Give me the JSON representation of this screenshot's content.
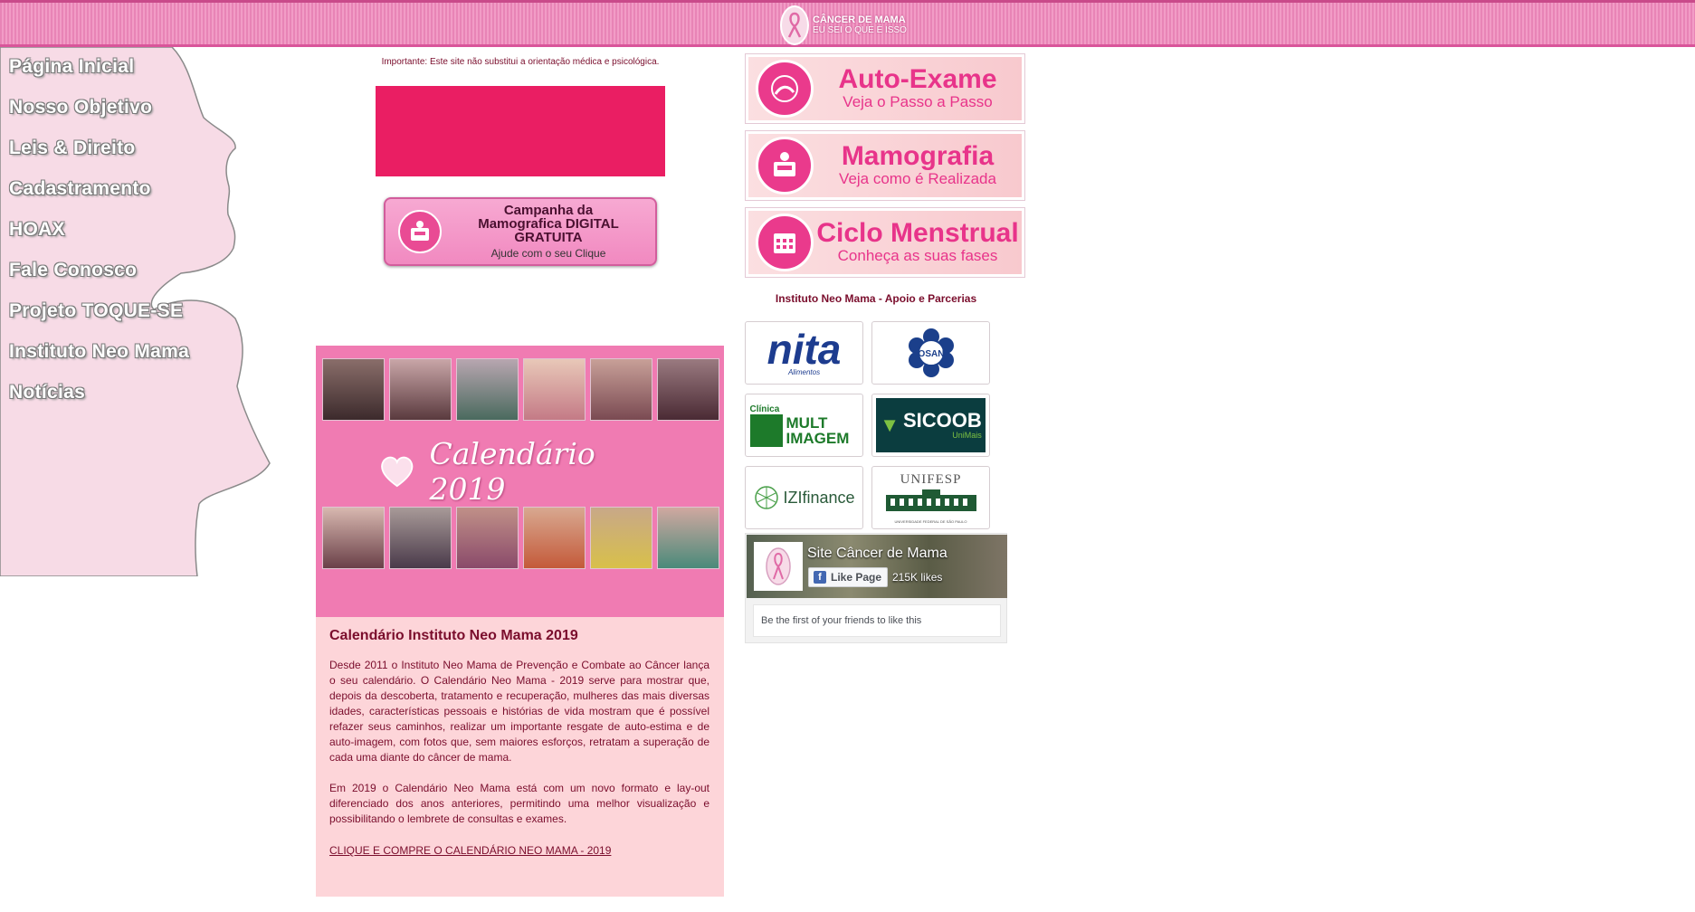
{
  "header": {
    "logo_line1": "CÂNCER DE MAMA",
    "logo_line2": "EU SEI O QUE É ISSO"
  },
  "nav": {
    "items": [
      {
        "label": "Página Inicial"
      },
      {
        "label": "Nosso Objetivo"
      },
      {
        "label": "Leis & Direito"
      },
      {
        "label": "Cadastramento"
      },
      {
        "label": "HOAX"
      },
      {
        "label": "Fale Conosco"
      },
      {
        "label": "Projeto TOQUE-SE"
      },
      {
        "label": "Instituto Neo Mama"
      },
      {
        "label": "Notícias"
      }
    ]
  },
  "notice": "Importante: Este site não substitui a orientação médica e psicológica.",
  "campaign": {
    "line1": "Campanha da",
    "line2": "Mamografica DIGITAL",
    "line3": "GRATUITA",
    "line4": "Ajude com o seu Clique"
  },
  "article": {
    "image_title": "Calendário 2019",
    "heading": "Calendário Instituto Neo Mama 2019",
    "paragraph1": "Desde 2011 o Instituto Neo Mama de Prevenção e Combate ao Câncer lança o seu calendário. O Calendário Neo Mama - 2019 serve para mostrar que, depois da descoberta, tratamento e recuperação, mulheres das mais diversas idades, características pessoais e histórias de vida mostram que é possível refazer seus caminhos, realizar um importante resgate de auto-estima e de auto-imagem, com fotos que, sem maiores esforços, retratam a superação de cada uma diante do câncer de mama.",
    "paragraph2": "Em 2019 o Calendário Neo Mama está com um novo formato e lay-out diferenciado dos anos anteriores, permitindo uma melhor visualização e possibilitando o lembrete de consultas e exames.",
    "link": "CLIQUE E COMPRE O CALENDÁRIO NEO MAMA - 2019"
  },
  "banners": [
    {
      "title": "Auto-Exame",
      "subtitle": "Veja o Passo a Passo"
    },
    {
      "title": "Mamografia",
      "subtitle": "Veja como é Realizada"
    },
    {
      "title": "Ciclo Menstrual",
      "subtitle": "Conheça as suas fases"
    }
  ],
  "partners": {
    "title": "Instituto Neo Mama - Apoio e Parcerias",
    "logos": {
      "nita": "nita",
      "nita_sub": "Alimentos",
      "osan": "OSAN",
      "multimagem_top": "Clínica",
      "multimagem_1": "MULT",
      "multimagem_2": "IMAGEM",
      "sicoob": "SICOOB",
      "sicoob_sub": "UniMais",
      "izi": "IZIfinance",
      "unifesp": "UNIFESP",
      "unifesp_sub": "UNIVERSIDADE FEDERAL DE SÃO PAULO"
    }
  },
  "facebook": {
    "page_name": "Site Câncer de Mama",
    "like_button": "Like Page",
    "likes": "215K likes",
    "friends_text": "Be the first of your friends to like this"
  },
  "colors": {
    "header_pink": "#f29cc6",
    "nav_bg": "#f7dbe6",
    "accent_pink": "#ea1e63",
    "article_bg": "#fdd5d9",
    "text_maroon": "#7a0d2c"
  }
}
